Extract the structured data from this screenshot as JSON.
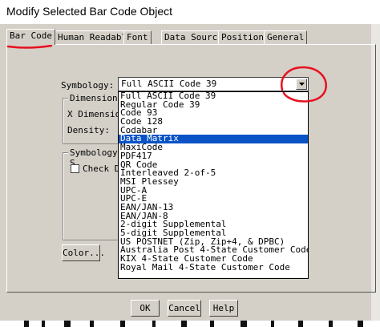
{
  "window": {
    "title": "Modify Selected Bar Code Object"
  },
  "tabs": [
    "Bar Code",
    "Human Readable",
    "Font",
    "Data Source",
    "Position",
    "General"
  ],
  "symbology": {
    "label": "Symbology:",
    "selected": "Full ASCII Code 39"
  },
  "dimensions": {
    "title": "Dimensions",
    "x_dimension": "X Dimension",
    "density": "Density:"
  },
  "symbology_settings": {
    "title": "Symbology S",
    "check_label": "Check Di"
  },
  "color_button": "Color...",
  "dropdown": {
    "selected_index": 5,
    "items": [
      "Full ASCII Code 39",
      "Regular Code 39",
      "Code 93",
      "Code 128",
      "Codabar",
      "Data Matrix",
      "MaxiCode",
      "PDF417",
      "QR Code",
      "Interleaved 2-of-5",
      "MSI Plessey",
      "UPC-A",
      "UPC-E",
      "EAN/JAN-13",
      "EAN/JAN-8",
      "2-digit Supplemental",
      "5-digit Supplemental",
      "US POSTNET (Zip, Zip+4, & DPBC)",
      "Australia Post 4-State Customer Code",
      "KIX 4-State Customer Code",
      "Royal Mail 4-State Customer Code"
    ]
  },
  "buttons": {
    "ok": "OK",
    "cancel": "Cancel",
    "help": "Help"
  },
  "colors": {
    "selection": "#0a53c6",
    "annotation": "#e8101e",
    "dialog": "#d4d0c8"
  }
}
